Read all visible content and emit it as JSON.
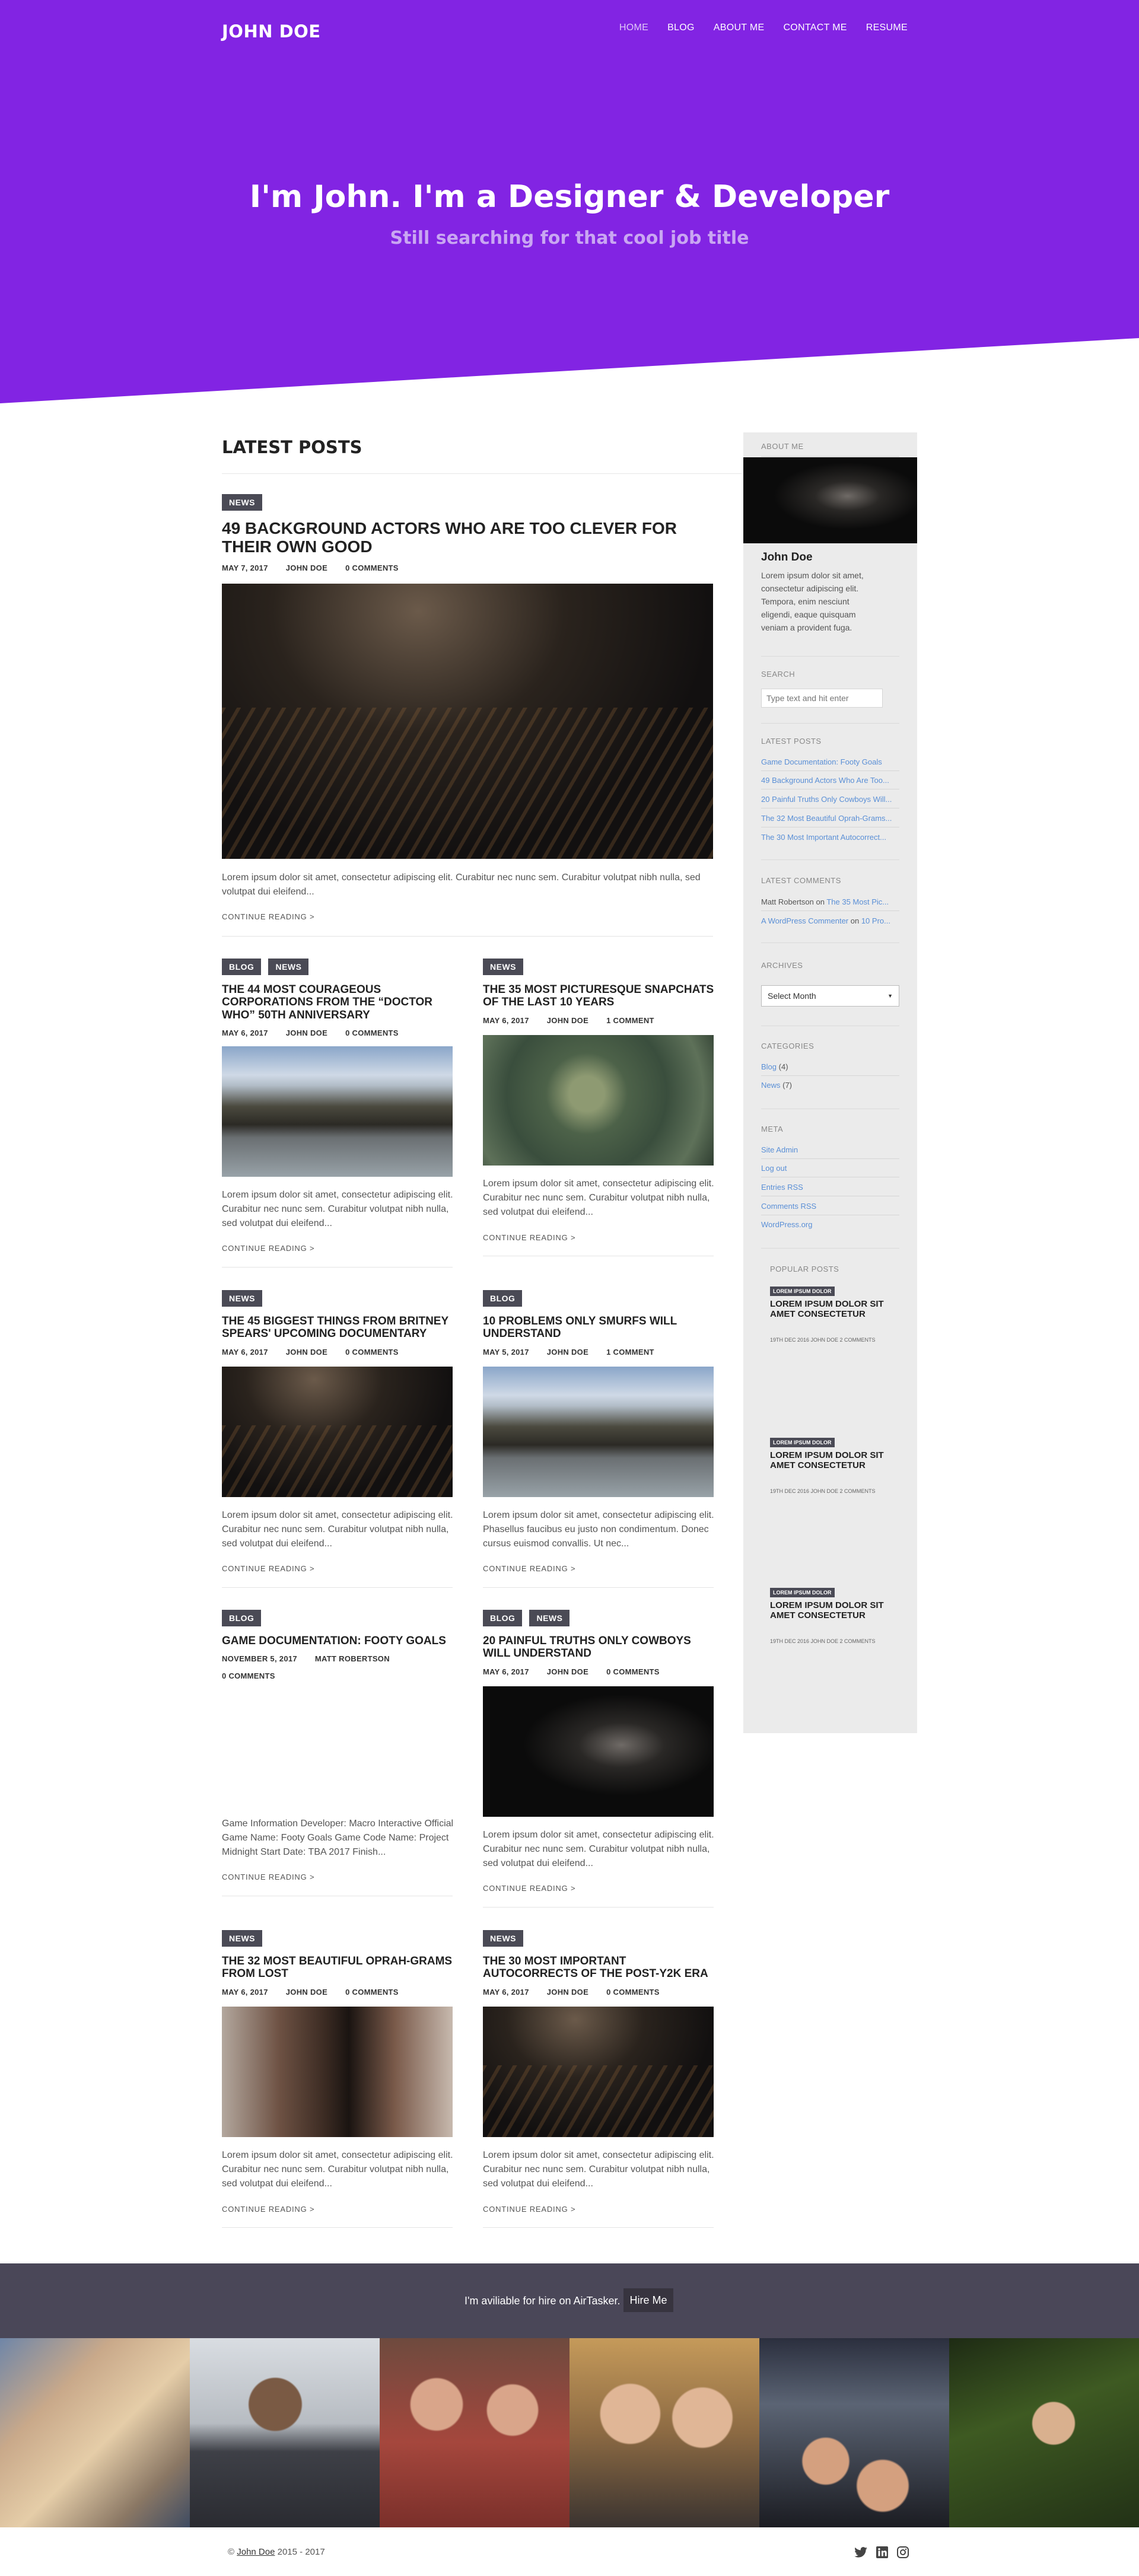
{
  "header": {
    "logo": "JOHN DOE",
    "nav": [
      "HOME",
      "BLOG",
      "ABOUT ME",
      "CONTACT ME",
      "RESUME"
    ],
    "active_nav": "HOME"
  },
  "hero": {
    "title": "I'm John. I'm a Designer & Developer",
    "subtitle": "Still searching for that cool job title"
  },
  "main": {
    "section_title": "LATEST POSTS",
    "read_more": "CONTINUE READING >",
    "featured": {
      "tags": [
        "NEWS"
      ],
      "title": "49 BACKGROUND ACTORS WHO ARE TOO CLEVER FOR THEIR OWN GOOD",
      "date": "MAY 7, 2017",
      "author": "JOHN DOE",
      "comments": "0 COMMENTS",
      "excerpt": "Lorem ipsum dolor sit amet, consectetur adipiscing elit. Curabitur nec nunc sem. Curabitur volutpat nibh nulla, sed volutpat dui eleifend..."
    },
    "posts": [
      {
        "tags": [
          "BLOG",
          "NEWS"
        ],
        "title": "THE 44 MOST COURAGEOUS CORPORATIONS FROM THE “DOCTOR WHO” 50TH ANNIVERSARY",
        "date": "MAY 6, 2017",
        "author": "JOHN DOE",
        "comments": "0 COMMENTS",
        "excerpt": "Lorem ipsum dolor sit amet, consectetur adipiscing elit. Curabitur nec nunc sem. Curabitur volutpat nibh nulla, sed volutpat dui eleifend..."
      },
      {
        "tags": [
          "NEWS"
        ],
        "title": "THE 35 MOST PICTURESQUE SNAPCHATS OF THE LAST 10 YEARS",
        "date": "MAY 6, 2017",
        "author": "JOHN DOE",
        "comments": "1 COMMENT",
        "excerpt": "Lorem ipsum dolor sit amet, consectetur adipiscing elit. Curabitur nec nunc sem. Curabitur volutpat nibh nulla, sed volutpat dui eleifend..."
      },
      {
        "tags": [
          "NEWS"
        ],
        "title": "THE 45 BIGGEST THINGS FROM BRITNEY SPEARS' UPCOMING DOCUMENTARY",
        "date": "MAY 6, 2017",
        "author": "JOHN DOE",
        "comments": "0 COMMENTS",
        "excerpt": "Lorem ipsum dolor sit amet, consectetur adipiscing elit. Curabitur nec nunc sem. Curabitur volutpat nibh nulla, sed volutpat dui eleifend..."
      },
      {
        "tags": [
          "BLOG"
        ],
        "title": "10 PROBLEMS ONLY SMURFS WILL UNDERSTAND",
        "date": "MAY 5, 2017",
        "author": "JOHN DOE",
        "comments": "1 COMMENT",
        "excerpt": "Lorem ipsum dolor sit amet, consectetur adipiscing elit. Phasellus faucibus eu justo non condimentum. Donec cursus euismod convallis. Ut nec..."
      },
      {
        "tags": [
          "BLOG"
        ],
        "title": "GAME DOCUMENTATION: FOOTY GOALS",
        "date": "NOVEMBER 5, 2017",
        "author": "MATT ROBERTSON",
        "comments": "0 COMMENTS",
        "excerpt": "Game Information Developer: Macro Interactive Official Game Name: Footy Goals Game Code Name: Project Midnight Start Date: TBA 2017 Finish..."
      },
      {
        "tags": [
          "BLOG",
          "NEWS"
        ],
        "title": "20 PAINFUL TRUTHS ONLY COWBOYS WILL UNDERSTAND",
        "date": "MAY 6, 2017",
        "author": "JOHN DOE",
        "comments": "0 COMMENTS",
        "excerpt": "Lorem ipsum dolor sit amet, consectetur adipiscing elit. Curabitur nec nunc sem. Curabitur volutpat nibh nulla, sed volutpat dui eleifend..."
      },
      {
        "tags": [
          "NEWS"
        ],
        "title": "THE 32 MOST BEAUTIFUL OPRAH-GRAMS FROM LOST",
        "date": "MAY 6, 2017",
        "author": "JOHN DOE",
        "comments": "0 COMMENTS",
        "excerpt": "Lorem ipsum dolor sit amet, consectetur adipiscing elit. Curabitur nec nunc sem. Curabitur volutpat nibh nulla, sed volutpat dui eleifend..."
      },
      {
        "tags": [
          "NEWS"
        ],
        "title": "THE 30 MOST IMPORTANT AUTOCORRECTS OF THE POST-Y2K ERA",
        "date": "MAY 6, 2017",
        "author": "JOHN DOE",
        "comments": "0 COMMENTS",
        "excerpt": "Lorem ipsum dolor sit amet, consectetur adipiscing elit. Curabitur nec nunc sem. Curabitur volutpat nibh nulla, sed volutpat dui eleifend..."
      }
    ]
  },
  "sidebar": {
    "about": {
      "label": "ABOUT ME",
      "name": "John Doe",
      "bio": [
        "Lorem ipsum dolor sit amet,",
        "consectetur adipiscing elit.",
        "Tempora, enim nesciunt",
        "eligendi, eaque quisquam",
        "veniam a provident fuga."
      ]
    },
    "search": {
      "label": "SEARCH",
      "placeholder": "Type text and hit enter"
    },
    "latest_posts": {
      "label": "LATEST POSTS",
      "items": [
        "Game Documentation: Footy Goals",
        "49 Background Actors Who Are Too...",
        "20 Painful Truths Only Cowboys Will...",
        "The 32 Most Beautiful Oprah-Grams...",
        "The 30 Most Important Autocorrect..."
      ]
    },
    "latest_comments": {
      "label": "LATEST COMMENTS",
      "items": [
        {
          "author": "Matt Robertson",
          "on": " on ",
          "post": "The 35 Most Pic..."
        },
        {
          "author": "A WordPress Commenter",
          "on": " on ",
          "post": "10 Pro..."
        }
      ]
    },
    "archives": {
      "label": "ARCHIVES",
      "select": "Select Month"
    },
    "categories": {
      "label": "CATEGORIES",
      "items": [
        {
          "name": "Blog",
          "count": " (4)"
        },
        {
          "name": "News",
          "count": " (7)"
        }
      ]
    },
    "meta": {
      "label": "META",
      "items": [
        "Site Admin",
        "Log out",
        "Entries RSS",
        "Comments RSS",
        "WordPress.org"
      ]
    },
    "popular": {
      "label": "POPULAR POSTS",
      "items": [
        {
          "tag": "LOREM IPSUM DOLOR",
          "title": "LOREM IPSUM DOLOR SIT AMET CONSECTETUR",
          "meta": "19TH DEC 2016  JOHN DOE  2 COMMENTS"
        },
        {
          "tag": "LOREM IPSUM DOLOR",
          "title": "LOREM IPSUM DOLOR SIT AMET CONSECTETUR",
          "meta": "19TH DEC 2016  JOHN DOE  2 COMMENTS"
        },
        {
          "tag": "LOREM IPSUM DOLOR",
          "title": "LOREM IPSUM DOLOR SIT AMET CONSECTETUR",
          "meta": "19TH DEC 2016  JOHN DOE  2 COMMENTS"
        }
      ]
    }
  },
  "footer": {
    "hire_text": "I'm aviliable for hire on AirTasker.",
    "hire_button": "Hire Me",
    "copyright_prefix": "© ",
    "copyright_name": "John Doe",
    "copyright_suffix": " 2015 - 2017",
    "social_icons": [
      "twitter-icon",
      "linkedin-icon",
      "instagram-icon"
    ]
  },
  "colors": {
    "hero": "#8224e3",
    "tag": "#4a4a55",
    "sidebar": "#ebebeb",
    "link": "#5a8fd6",
    "footer_band": "#4a4758"
  }
}
